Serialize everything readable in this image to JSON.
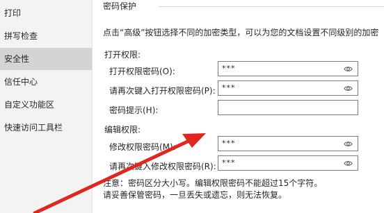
{
  "sidebar": {
    "items": [
      {
        "label": "打印"
      },
      {
        "label": "拼写检查"
      },
      {
        "label": "安全性"
      },
      {
        "label": "信任中心"
      },
      {
        "label": "自定义功能区"
      },
      {
        "label": "快速访问工具栏"
      }
    ],
    "active_index": 2
  },
  "password_protection": {
    "header": "密码保护",
    "description": "点击“高级”按钮选择不同的加密类型，可以为您的文档设置不同级别的加密",
    "open_section": {
      "label": "打开权限:",
      "password_label": "打开权限密码(O):",
      "password_value": "***",
      "confirm_label": "请再次键入打开权限密码(P):",
      "confirm_value": "***",
      "hint_label": "密码提示(H):",
      "hint_value": ""
    },
    "edit_section": {
      "label": "编辑权限:",
      "password_label": "修改权限密码(M):",
      "password_value": "***",
      "confirm_label": "请再次键入修改权限密码(R):",
      "confirm_value": "***"
    },
    "note_line1": "注意：密码区分大小写。编辑权限密码不能超过15个字符。",
    "note_line2": "请妥善保管密码，一旦丢失或遗忘，则无法恢复。"
  },
  "colors": {
    "sidebar_bg": "#f3f3f3",
    "sidebar_active": "#d4d4d4",
    "annotation_arrow": "#e0261f"
  },
  "icons": [
    "eye-icon"
  ]
}
